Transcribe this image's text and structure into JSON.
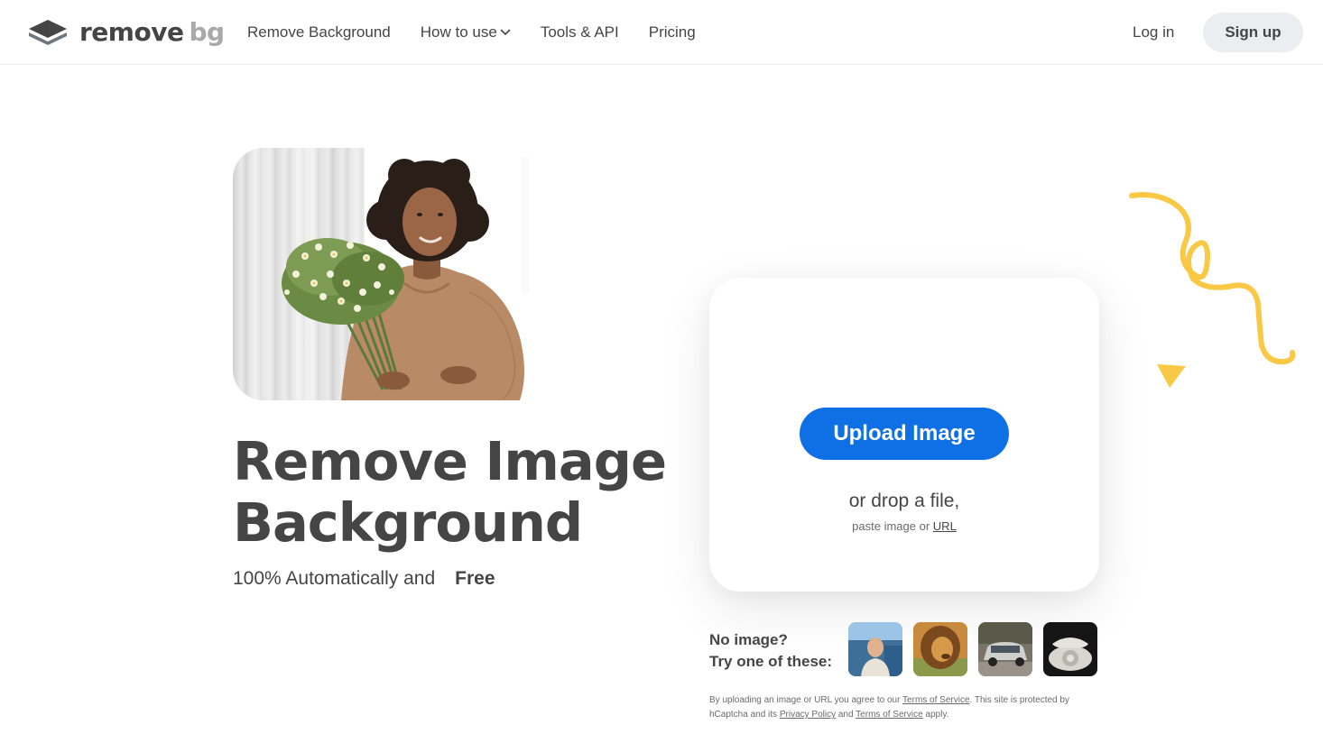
{
  "header": {
    "logo_text_main": "remove",
    "logo_text_accent": "bg",
    "nav": [
      {
        "label": "Remove Background"
      },
      {
        "label": "How to use"
      },
      {
        "label": "Tools & API"
      },
      {
        "label": "Pricing"
      }
    ],
    "login_label": "Log in",
    "signup_label": "Sign up"
  },
  "hero": {
    "title_line1": "Remove Image",
    "title_line2": "Background",
    "subtitle": "100% Automatically and",
    "free_badge": "Free"
  },
  "upload": {
    "button_label": "Upload Image",
    "drop_text": "or drop a file,",
    "paste_prefix": "paste image or",
    "url_link": "URL"
  },
  "samples": {
    "prompt_line1": "No image?",
    "prompt_line2": "Try one of these:",
    "items": [
      {
        "name": "man"
      },
      {
        "name": "lion"
      },
      {
        "name": "car"
      },
      {
        "name": "telephone"
      }
    ]
  },
  "legal": {
    "part1": "By uploading an image or URL you agree to our",
    "tos1": "Terms of Service",
    "part2": ". This site is protected by hCaptcha and its",
    "privacy": "Privacy Policy",
    "part3": "and",
    "tos2": "Terms of Service",
    "part4": "apply."
  },
  "colors": {
    "primary": "#0f70e6",
    "accent_yellow": "#f9c945",
    "text": "#454545",
    "signup_bg": "#ebedf0"
  }
}
